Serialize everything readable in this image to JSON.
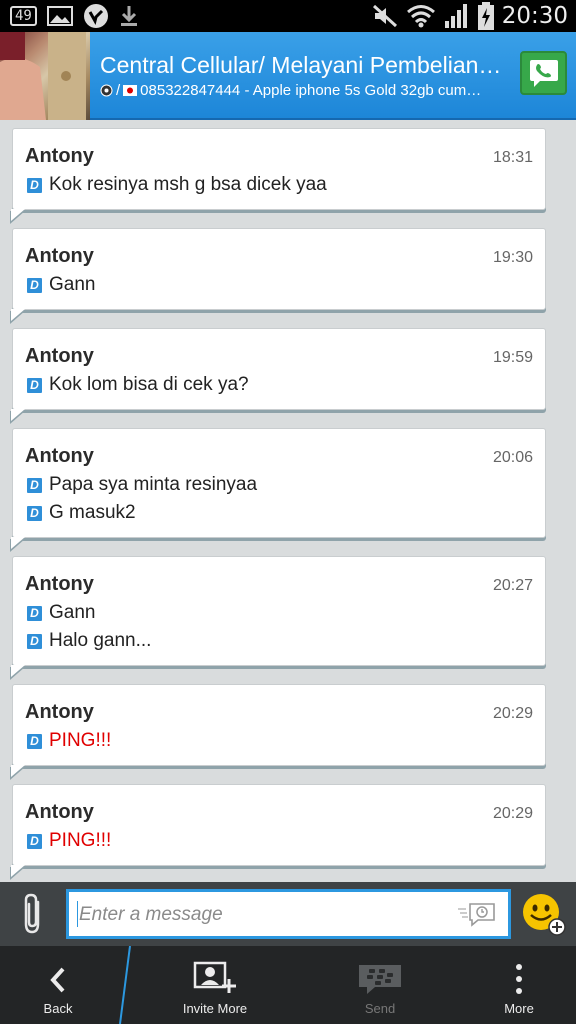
{
  "status_bar": {
    "battery_badge": "49",
    "time": "20:30"
  },
  "header": {
    "title": "Central Cellular/ Melayani Pembelian…",
    "subtitle": "085322847444 - Apple iphone 5s Gold 32gb cum…",
    "subtitle_separator": "/"
  },
  "messages": [
    {
      "sender": "Antony",
      "time": "18:31",
      "lines": [
        "Kok resinya msh g bsa dicek yaa"
      ],
      "ping": false
    },
    {
      "sender": "Antony",
      "time": "19:30",
      "lines": [
        "Gann"
      ],
      "ping": false
    },
    {
      "sender": "Antony",
      "time": "19:59",
      "lines": [
        "Kok lom bisa di cek ya?"
      ],
      "ping": false
    },
    {
      "sender": "Antony",
      "time": "20:06",
      "lines": [
        "Papa sya minta resinyaa",
        "G masuk2"
      ],
      "ping": false
    },
    {
      "sender": "Antony",
      "time": "20:27",
      "lines": [
        "Gann",
        "Halo gann..."
      ],
      "ping": false
    },
    {
      "sender": "Antony",
      "time": "20:29",
      "lines": [
        "PING!!!"
      ],
      "ping": true
    },
    {
      "sender": "Antony",
      "time": "20:29",
      "lines": [
        "PING!!!"
      ],
      "ping": true
    }
  ],
  "delivery_marker": "D",
  "composer": {
    "placeholder": "Enter a message"
  },
  "actions": {
    "back": "Back",
    "invite_more": "Invite More",
    "send": "Send",
    "more": "More"
  },
  "colors": {
    "header": "#1d86d8",
    "ping": "#e00000",
    "accent": "#2c98e0",
    "call": "#37a84a"
  }
}
